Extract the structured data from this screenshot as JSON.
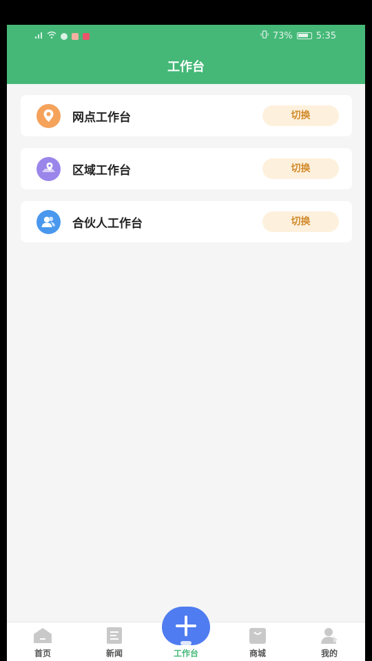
{
  "status_bar": {
    "battery": "73%",
    "time": "5:35"
  },
  "header": {
    "title": "工作台"
  },
  "workbench_list": [
    {
      "label": "网点工作台",
      "button": "切换",
      "icon": "location-pin-icon",
      "color": "#f39a4a"
    },
    {
      "label": "区域工作台",
      "button": "切换",
      "icon": "map-pin-icon",
      "color": "#8e7be6"
    },
    {
      "label": "合伙人工作台",
      "button": "切换",
      "icon": "partner-icon",
      "color": "#3f8fe8"
    }
  ],
  "tabbar": {
    "items": [
      {
        "label": "首页",
        "icon": "home-icon"
      },
      {
        "label": "新闻",
        "icon": "news-icon"
      },
      {
        "label": "工作台",
        "icon": "add-icon",
        "active": true
      },
      {
        "label": "商城",
        "icon": "shop-bag-icon"
      },
      {
        "label": "我的",
        "icon": "user-icon"
      }
    ]
  },
  "colors": {
    "brand": "#45b878",
    "switch_bg": "#fdf1dd",
    "switch_text": "#d28a2c",
    "fab": "#4f7cf0"
  }
}
